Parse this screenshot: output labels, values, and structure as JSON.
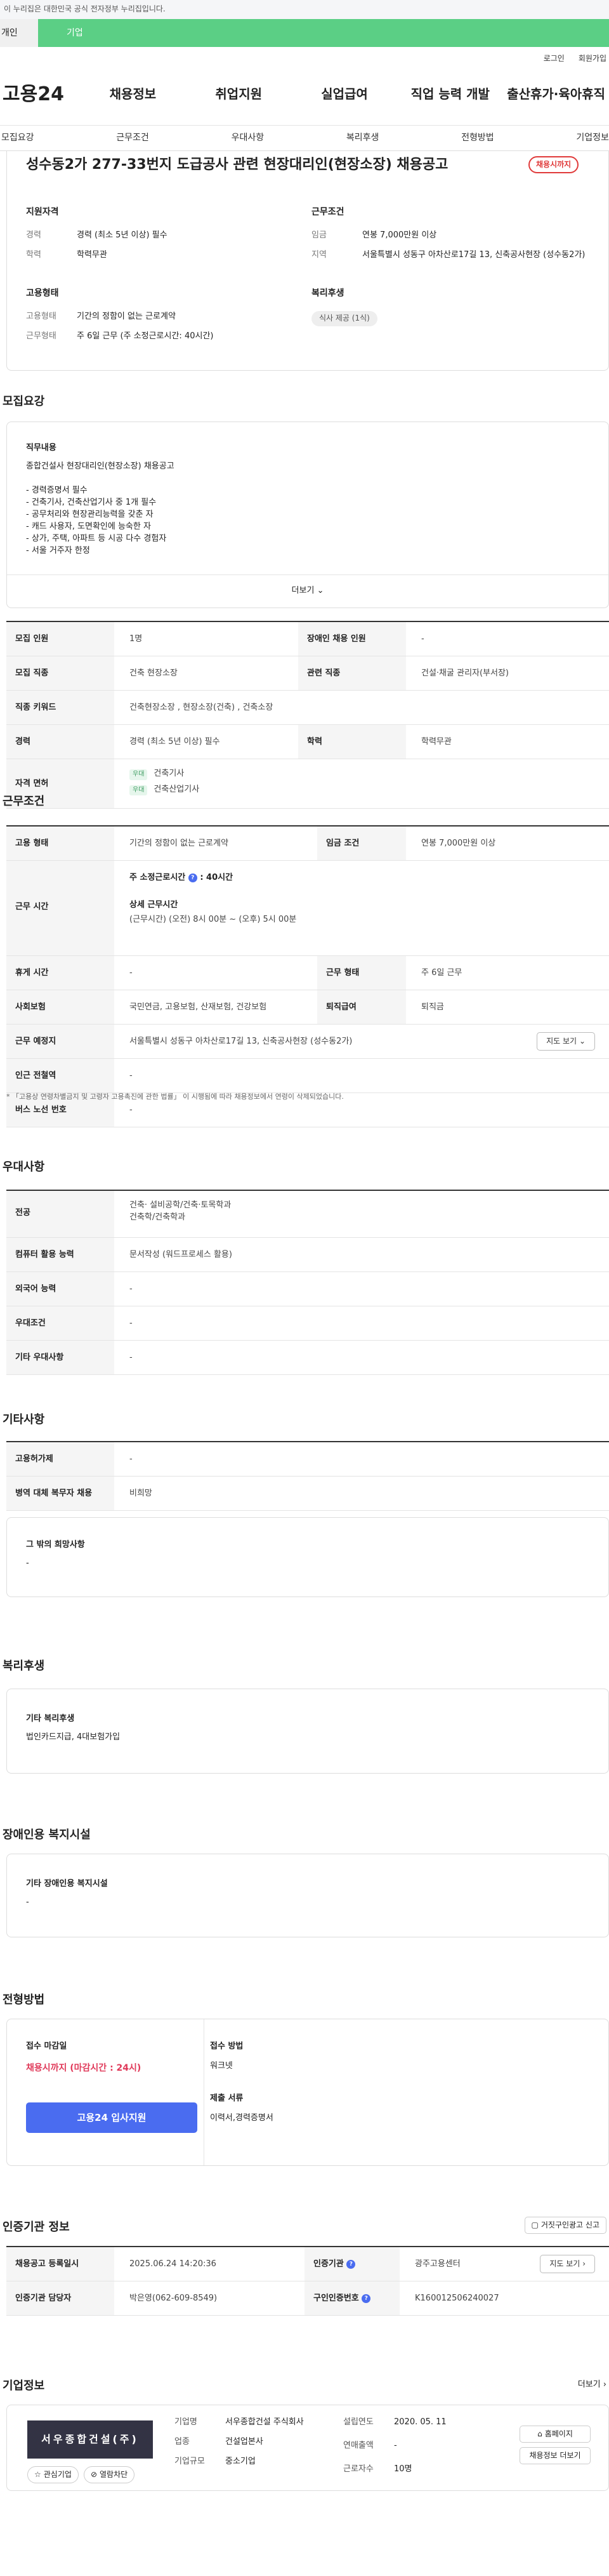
{
  "gov_banner": "이 누리집은 대한민국 공식 전자정부 누리집입니다.",
  "portal_tabs": [
    "개인",
    "기업"
  ],
  "util_links": [
    "로그인",
    "회원가입"
  ],
  "gnb": {
    "logo": "고용24",
    "items": [
      "채용정보",
      "취업지원",
      "실업급여",
      "직업 능력 개발",
      "출산휴가·육아휴직"
    ]
  },
  "anchors": [
    "모집요강",
    "근무조건",
    "우대사항",
    "복리후생",
    "전형방법",
    "기업정보"
  ],
  "hero": {
    "title": "성수동2가 277-33번지 도급공사 관련 현장대리인(현장소장) 채용공고",
    "badge": "채용시까지",
    "qual": {
      "heading": "지원자격",
      "rows": [
        [
          "경력",
          "경력 (최소 5년 이상) 필수"
        ],
        [
          "학력",
          "학력무관"
        ]
      ]
    },
    "cond": {
      "heading": "근무조건",
      "rows": [
        [
          "임금",
          "연봉 7,000만원 이상"
        ],
        [
          "지역",
          "서울특별시 성동구 아차산로17길 13, 신축공사현장 (성수동2가)"
        ]
      ]
    },
    "emp": {
      "heading": "고용형태",
      "rows": [
        [
          "고용형태",
          "기간의 정함이 없는 근로계약"
        ],
        [
          "근무형태",
          "주 6일 근무 (주 소정근로시간: 40시간)"
        ]
      ]
    },
    "welfare": {
      "heading": "복리후생",
      "tag": "식사 제공 (1식)"
    }
  },
  "recruit": {
    "title": "모집요강",
    "job_title": "직무내용",
    "job_lines": [
      "종합건설사 현장대리인(현장소장) 채용공고",
      "",
      "- 경력증명서 필수",
      "- 건축기사, 건축산업기사 중 1개 필수",
      "- 공무처리와 현장관리능력을 갖춘 자",
      "- 캐드 사용자, 도면확인에 능숙한 자",
      "- 상가, 주택, 아파트 등 시공 다수 경험자",
      "- 서울 거주자 한정"
    ],
    "more": "더보기",
    "rows": [
      {
        "k1": "모집 인원",
        "v1": "1명",
        "k2": "장애인 채용 인원",
        "v2": "-"
      },
      {
        "k1": "모집 직종",
        "v1": "건축 현장소장",
        "k2": "관련 직종",
        "v2": "건설·채굴 관리자(부서장)"
      },
      {
        "k1": "직종 키워드",
        "v1": "건축현장소장 , 현장소장(건축) , 건축소장"
      },
      {
        "k1": "경력",
        "v1": "경력 (최소 5년 이상) 필수",
        "k2": "학력",
        "v2": "학력무관"
      }
    ],
    "license_key": "자격 면허",
    "license_tag": "우대",
    "licenses": [
      "건축기사",
      "건축산업기사"
    ]
  },
  "work": {
    "title": "근무조건",
    "emp_key": "고용 형태",
    "emp_val": "기간의 정함이 없는 근로계약",
    "wage_key": "임금 조건",
    "wage_val": "연봉 7,000만원 이상",
    "time_key": "근무 시간",
    "time_week": "주 소정근로시간",
    "time_week_val": ": 40시간",
    "time_detail_head": "상세 근무시간",
    "time_detail": "(근무시간) (오전) 8시 00분 ~ (오후) 5시 00분",
    "rest_key": "휴게 시간",
    "rest_val": "-",
    "form_key": "근무 형태",
    "form_val": "주 6일 근무",
    "ins_key": "사회보험",
    "ins_val": "국민연금, 고용보험, 산재보험, 건강보험",
    "sev_key": "퇴직급여",
    "sev_val": "퇴직금",
    "loc_key": "근무 예정지",
    "loc_val": "서울특별시 성동구 아차산로17길 13, 신축공사현장 (성수동2가)",
    "map_btn": "지도 보기",
    "subway_key": "인근 전철역",
    "subway_val": "-",
    "bus_key": "버스 노선 번호",
    "bus_val": "-",
    "note": "* 「고용상 연령차별금지 및 고령자 고용촉진에 관한 법률」 이 시행됨에 따라 채용정보에서 연령이 삭제되었습니다."
  },
  "pref": {
    "title": "우대사항",
    "rows": [
      [
        "전공",
        "건축· 설비공학/건축·토목학과\n건축학/건축학과"
      ],
      [
        "컴퓨터 활용 능력",
        "문서작성 (워드프로세스 활용)"
      ],
      [
        "외국어 능력",
        "-"
      ],
      [
        "우대조건",
        "-"
      ],
      [
        "기타 우대사항",
        "-"
      ]
    ]
  },
  "etc": {
    "title": "기타사항",
    "rows": [
      [
        "고용허가제",
        "-"
      ],
      [
        "병역 대체 복무자 채용",
        "비희망"
      ]
    ],
    "other_title": "그 밖의 희망사항",
    "other_val": "-"
  },
  "benefit": {
    "title": "복리후생",
    "sub": "기타 복리후생",
    "val": "법인카드지급, 4대보험가입"
  },
  "disabled": {
    "title": "장애인용 복지시설",
    "sub": "기타 장애인용 복지시설",
    "val": "-"
  },
  "selection": {
    "title": "전형방법",
    "deadline_head": "접수 마감일",
    "deadline_val": "채용시까지 (마감시간 : 24시)",
    "apply_btn": "고용24 입사지원",
    "method_head": "접수 방법",
    "method_val": "워크넷",
    "docs_head": "제출 서류",
    "docs_val": "이력서,경력증명서"
  },
  "cert": {
    "title": "인증기관 정보",
    "report_btn": "거짓구인광고 신고",
    "rows": [
      {
        "k1": "채용공고 등록일시",
        "v1": "2025.06.24 14:20:36",
        "k2": "인증기관",
        "v2": "광주고용센터",
        "btn": "지도 보기"
      },
      {
        "k1": "인증기관 담당자",
        "v1": "박은영(062-609-8549)",
        "k2": "구인인증번호",
        "v2": "K160012506240027"
      }
    ]
  },
  "company": {
    "title": "기업정보",
    "more": "더보기",
    "logo_text": "서우종합건설(주)",
    "interest_btn": "관심기업",
    "block_btn": "열람차단",
    "fields": [
      [
        "기업명",
        "서우종합건설 주식회사"
      ],
      [
        "업종",
        "건설업본사"
      ],
      [
        "기업규모",
        "중소기업"
      ]
    ],
    "fields2": [
      [
        "설립연도",
        "2020. 05. 11"
      ],
      [
        "연매출액",
        "-"
      ],
      [
        "근로자수",
        "10명"
      ]
    ],
    "home_btn": "홈페이지",
    "info_btn": "채용정보 더보기"
  }
}
